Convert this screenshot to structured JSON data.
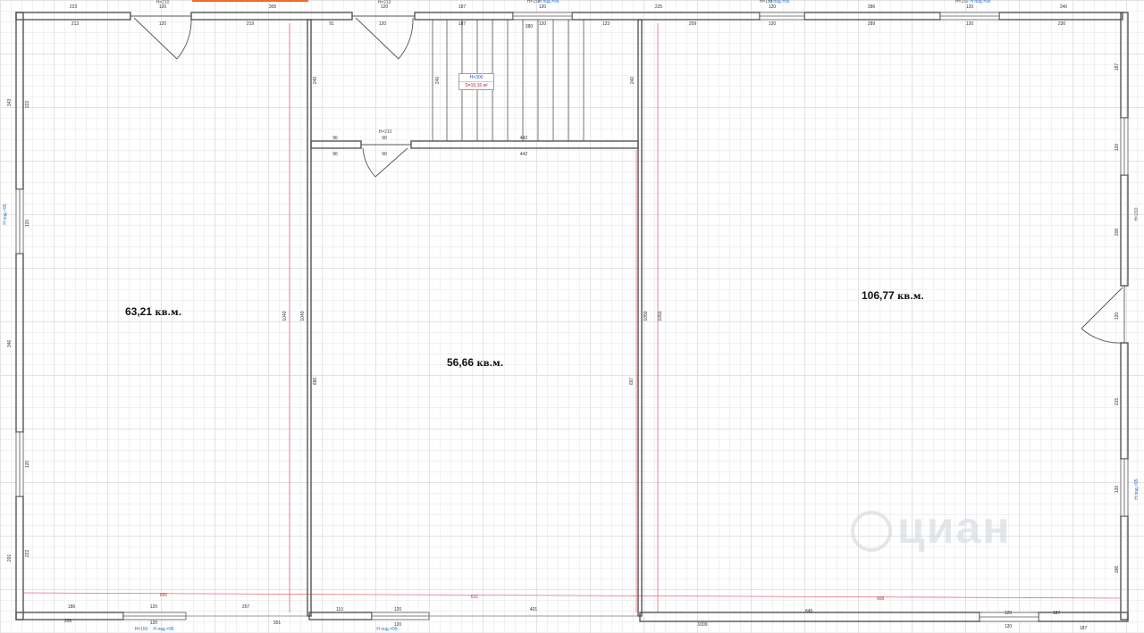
{
  "rooms": {
    "left": {
      "area": "63,21",
      "unit": "кв.м."
    },
    "center": {
      "area": "56,66",
      "unit": "кв.м."
    },
    "right": {
      "area": "106,77",
      "unit": "кв.м."
    }
  },
  "stair": {
    "height": "H=300",
    "area": "S=15,16 м²"
  },
  "watermark": {
    "text": "циан"
  },
  "dimensions": {
    "top_outer": [
      "223",
      "120",
      "305",
      "120",
      "187",
      "120",
      "225",
      "120",
      "286",
      "120",
      "240"
    ],
    "top_inner": [
      "213",
      "120",
      "219",
      "91",
      "120",
      "187",
      "380",
      "120",
      "123",
      "209",
      "120",
      "289",
      "120",
      "230"
    ],
    "bottom_inner": [
      "186",
      "120",
      "257",
      "110",
      "120",
      "401",
      "849",
      "120",
      "187"
    ],
    "bottom_outer": [
      "206",
      "120",
      "301",
      "120",
      "1009",
      "120",
      "187"
    ],
    "left_side": [
      "343",
      "222",
      "120",
      "346",
      "120",
      "201",
      "222"
    ],
    "right_side": [
      "187",
      "120",
      "206",
      "120",
      "215",
      "120",
      "186"
    ],
    "partition_values": [
      "96",
      "90",
      "442",
      "96",
      "90",
      "442",
      "240",
      "240",
      "240"
    ],
    "vertical_long": [
      "1040",
      "1040",
      "1050",
      "1050",
      "686",
      "697"
    ],
    "red_guides": [
      "650",
      "631",
      "908"
    ],
    "opening_heights": [
      "H=210",
      "H=210",
      "H=150",
      "H=210",
      "H=150",
      "H=150",
      "H=210"
    ],
    "window_notes": [
      "H=150",
      "H под.=95",
      "H под.=95",
      "H под.=95",
      "H под.=95",
      "H под.=95",
      "H под.=95",
      "H под.=95"
    ]
  }
}
